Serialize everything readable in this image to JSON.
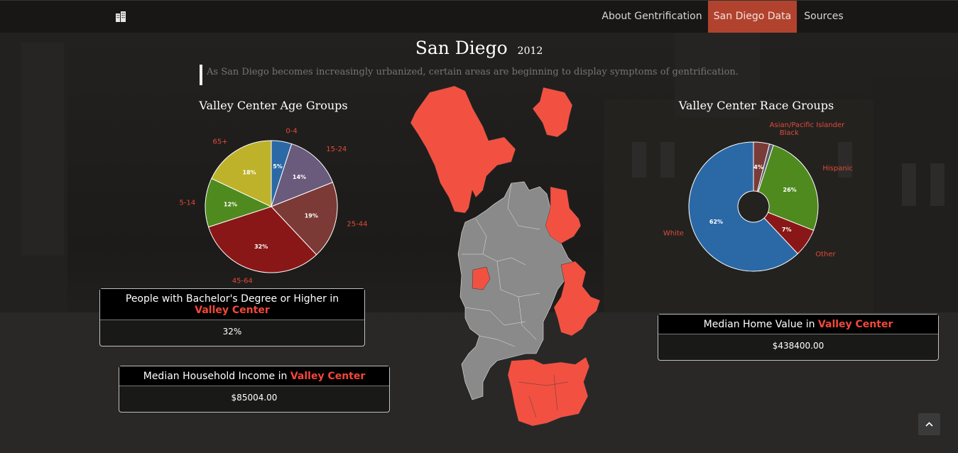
{
  "nav": {
    "logo_icon": "building-icon",
    "items": [
      {
        "label": "About Gentrification",
        "active": false
      },
      {
        "label": "San Diego Data",
        "active": true
      },
      {
        "label": "Sources",
        "active": false
      }
    ]
  },
  "header": {
    "city": "San Diego",
    "year": "2012",
    "tagline": "As San Diego becomes increasingly urbanized, certain areas are beginning to display symptoms of gentrification."
  },
  "colors": {
    "accent": "#b1432e",
    "highlight": "#f2483a",
    "map_gentrified": "#f25142",
    "map_other": "#8a8a8a"
  },
  "age_chart": {
    "title": "Valley Center Age Groups",
    "chart_data": {
      "type": "pie",
      "slices": [
        {
          "label": "0-4",
          "value": 5,
          "pct": "5%",
          "color": "#2a69a6"
        },
        {
          "label": "15-24",
          "value": 14,
          "pct": "14%",
          "color": "#6a5a7c"
        },
        {
          "label": "25-44",
          "value": 19,
          "pct": "19%",
          "color": "#7b3a36"
        },
        {
          "label": "45-64",
          "value": 32,
          "pct": "32%",
          "color": "#8a1718"
        },
        {
          "label": "5-14",
          "value": 12,
          "pct": "12%",
          "color": "#4f8a1f"
        },
        {
          "label": "65+",
          "value": 18,
          "pct": "18%",
          "color": "#bdb22a"
        }
      ]
    }
  },
  "race_chart": {
    "title": "Valley Center Race Groups",
    "chart_data": {
      "type": "pie",
      "donut": true,
      "slices": [
        {
          "label": "Asian/Pacific Islander",
          "value": 4,
          "pct": "4%",
          "color": "#7a3c38"
        },
        {
          "label": "Black",
          "value": 1,
          "pct": "",
          "color": "#5a5a6a"
        },
        {
          "label": "Hispanic",
          "value": 26,
          "pct": "26%",
          "color": "#4f8a1f"
        },
        {
          "label": "Other",
          "value": 7,
          "pct": "7%",
          "color": "#8a1718"
        },
        {
          "label": "White",
          "value": 62,
          "pct": "62%",
          "color": "#2a69a6"
        }
      ]
    }
  },
  "stats": {
    "bachelor": {
      "label": "People with Bachelor's Degree or Higher in",
      "location": "Valley Center",
      "value": "32%"
    },
    "income": {
      "label": "Median Household Income in",
      "location": "Valley Center",
      "value": "$85004.00"
    },
    "home": {
      "label": "Median Home Value in",
      "location": "Valley Center",
      "value": "$438400.00"
    }
  },
  "scroll_top_icon": "chevron-up-icon"
}
